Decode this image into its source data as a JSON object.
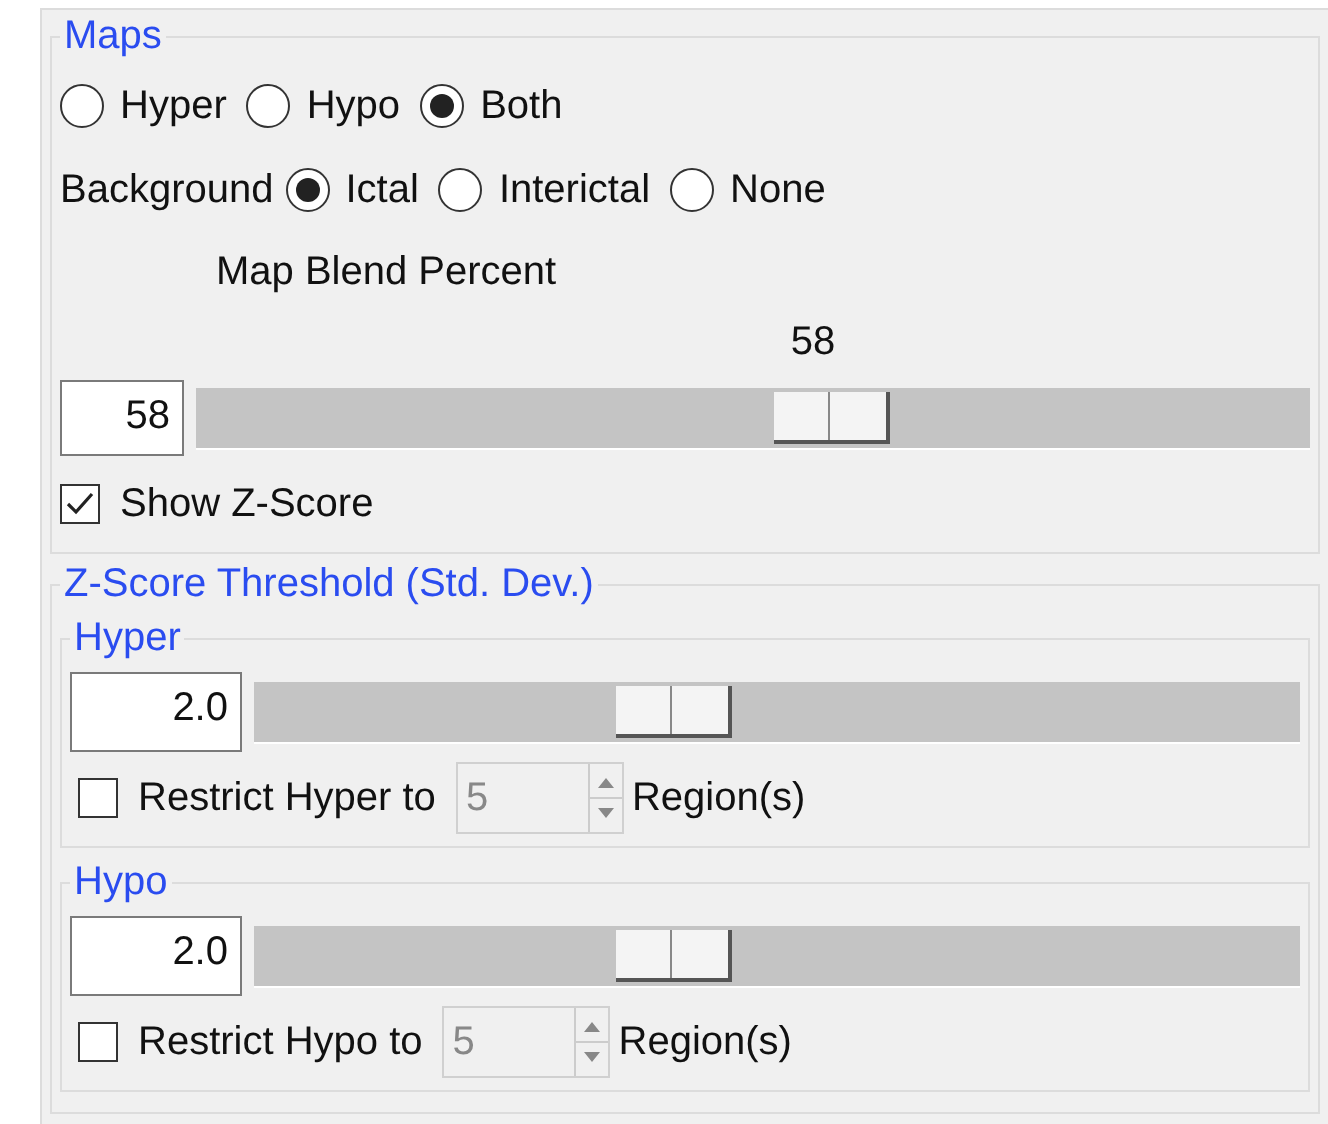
{
  "maps": {
    "title": "Maps",
    "mode_options": [
      {
        "label": "Hyper",
        "selected": false
      },
      {
        "label": "Hypo",
        "selected": false
      },
      {
        "label": "Both",
        "selected": true
      }
    ],
    "background_label": "Background",
    "background_options": [
      {
        "label": "Ictal",
        "selected": true
      },
      {
        "label": "Interictal",
        "selected": false
      },
      {
        "label": "None",
        "selected": false
      }
    ],
    "blend": {
      "label": "Map Blend Percent",
      "reading": "58",
      "value": "58",
      "level": 0.58
    },
    "show_zscore": {
      "label": "Show Z-Score",
      "checked": true
    }
  },
  "zscore": {
    "title": "Z-Score Threshold (Std. Dev.)",
    "groups": [
      {
        "title": "Hyper",
        "value": "2.0",
        "level": 0.39,
        "restrict": {
          "label": "Restrict Hyper to",
          "checked": false,
          "value": "5",
          "disabled": true,
          "unit": "Region(s)"
        }
      },
      {
        "title": "Hypo",
        "value": "2.0",
        "level": 0.39,
        "restrict": {
          "label": "Restrict Hypo to",
          "checked": false,
          "value": "5",
          "disabled": true,
          "unit": "Region(s)"
        }
      }
    ]
  }
}
